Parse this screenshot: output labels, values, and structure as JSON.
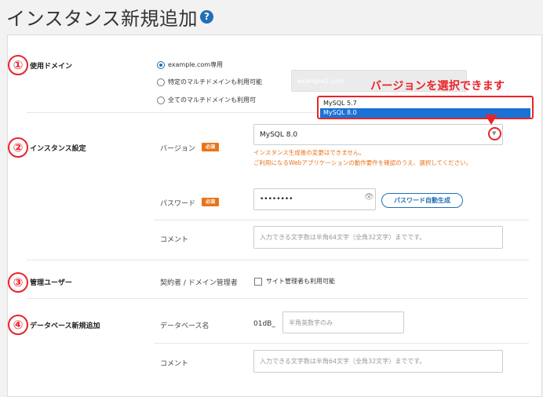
{
  "header": {
    "title": "インスタンス新規追加",
    "help_icon": "?"
  },
  "sections": {
    "domain": {
      "number": "①",
      "label": "使用ドメイン",
      "options": [
        {
          "label": "example.com専用",
          "selected": true
        },
        {
          "label": "特定のマルチドメインも利用可能",
          "selected": false
        },
        {
          "label": "全てのマルチドメインも利用可",
          "selected": false
        }
      ],
      "domain_value": "example2.com"
    },
    "instance": {
      "number": "②",
      "label": "インスタンス設定",
      "version_label": "バージョン",
      "required_badge": "必須",
      "version_value": "MySQL 8.0",
      "version_options": [
        "MySQL 5.7",
        "MySQL 8.0"
      ],
      "version_selected_index": 1,
      "notice_line1": "インスタンス生成後の変更はできません。",
      "notice_line2": "ご利用になるWebアプリケーションの動作要件を確認のうえ、選択してください。",
      "password_label": "パスワード",
      "password_value": "••••••••",
      "password_generate_button": "パスワード自動生成",
      "comment_label": "コメント",
      "comment_placeholder": "入力できる文字数は半角64文字（全角32文字）までです。"
    },
    "admin_user": {
      "number": "③",
      "label": "管理ユーザー",
      "field_label": "契約者 / ドメイン管理者",
      "checkbox_label": "サイト管理者も利用可能"
    },
    "database": {
      "number": "④",
      "label": "データベース新規追加",
      "name_label": "データベース名",
      "name_prefix": "01dB_",
      "name_placeholder": "半角英数字のみ",
      "comment_label": "コメント",
      "comment_placeholder": "入力できる文字数は半角64文字（全角32文字）までです。"
    }
  },
  "annotation": {
    "callout": "バージョンを選択できます"
  },
  "colors": {
    "accent_blue": "#1f6fb5",
    "required_orange": "#e8741a",
    "annotation_red": "#e8242a",
    "selected_option": "#1a72d6"
  }
}
